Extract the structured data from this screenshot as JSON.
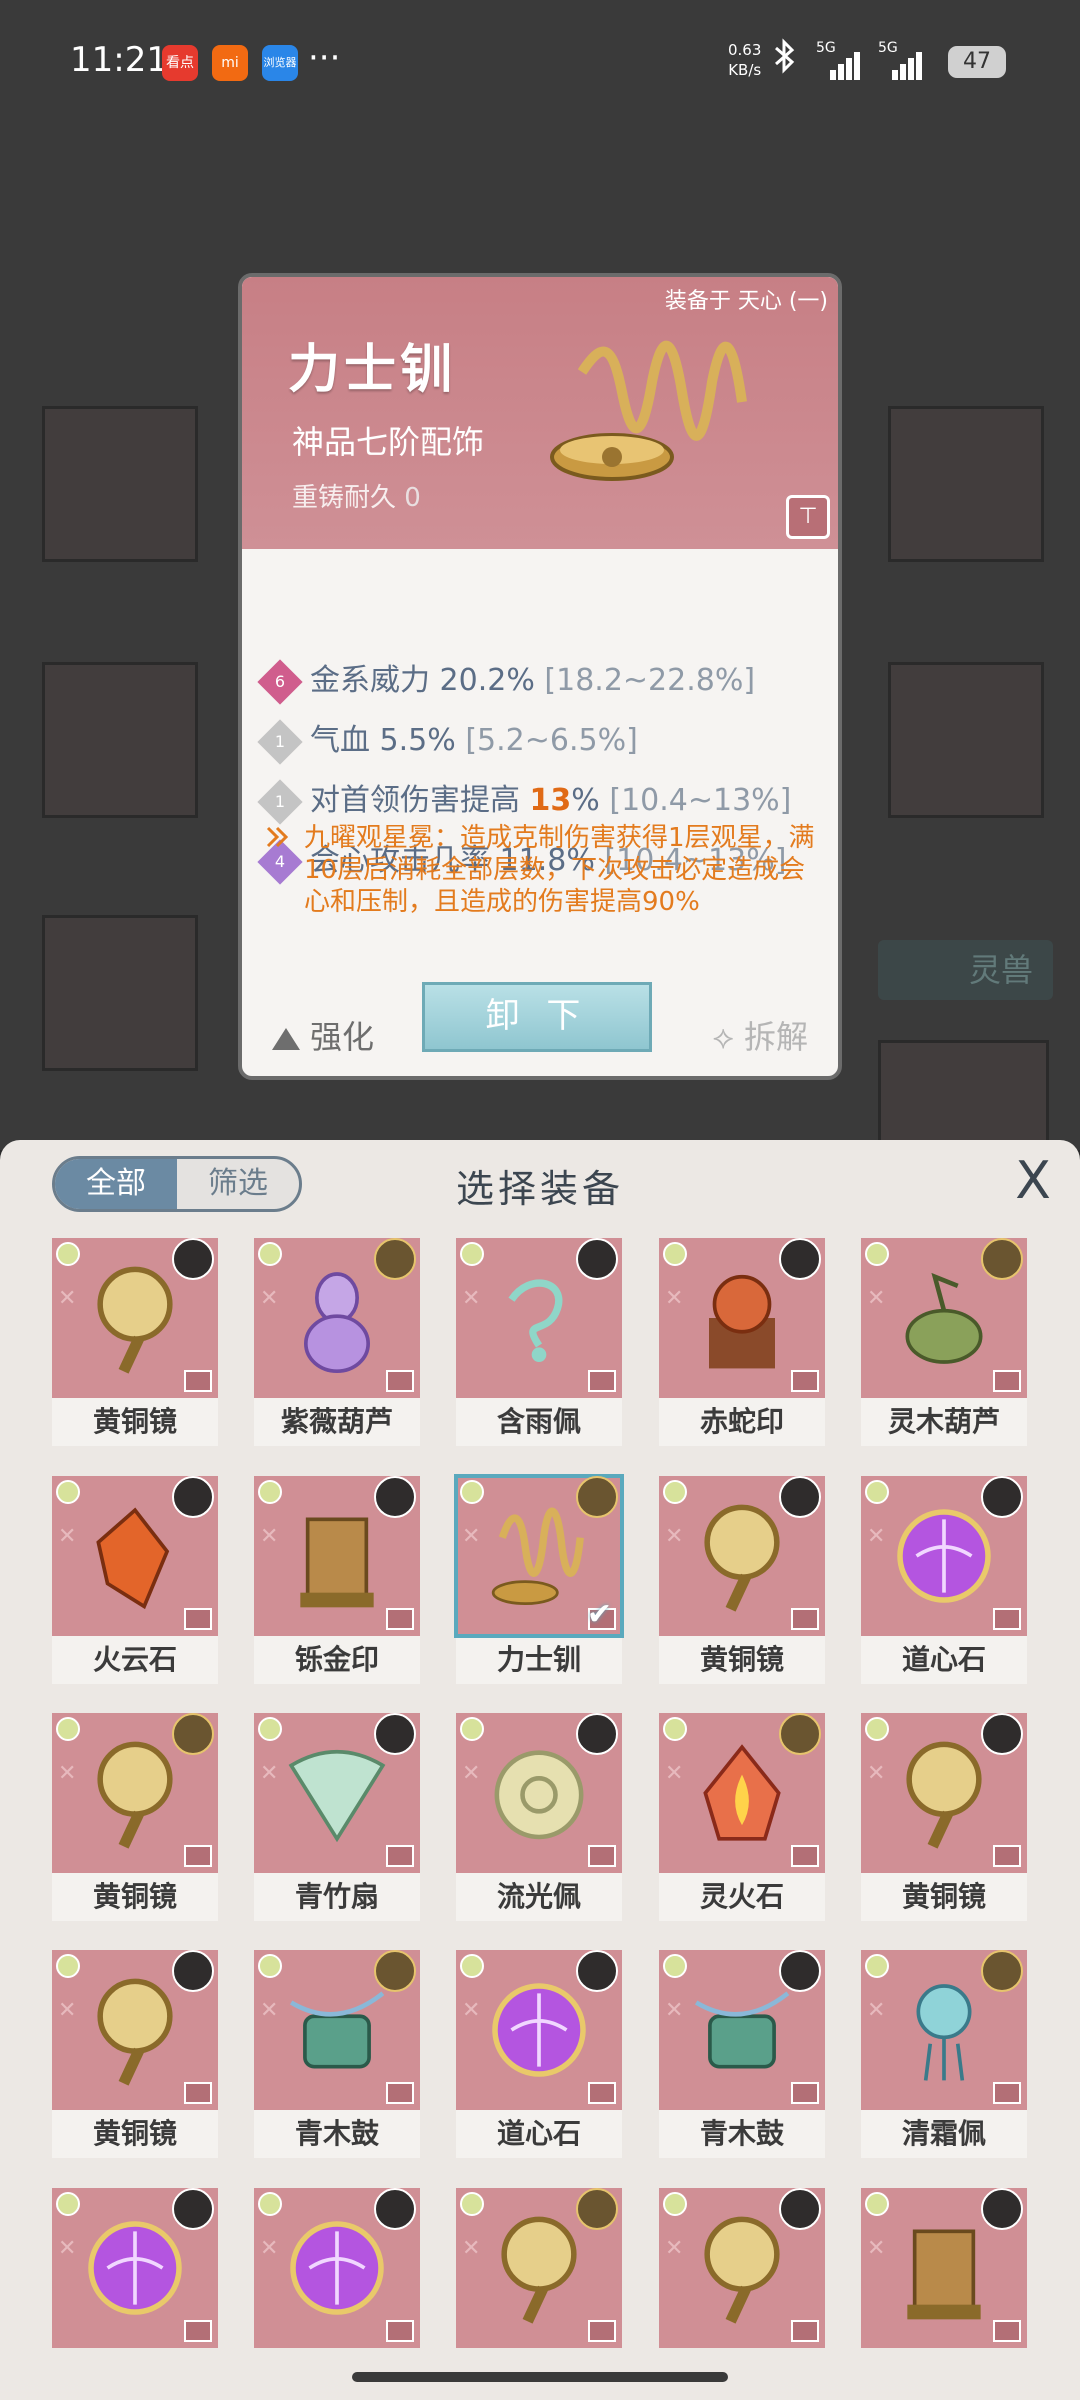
{
  "status_bar": {
    "time": "11:21",
    "apps": [
      "看点",
      "mi",
      "浏览器"
    ],
    "more": "···",
    "net_speed_value": "0.63",
    "net_speed_unit": "KB/s",
    "sim1": "5G",
    "sim2": "5G",
    "battery": "47"
  },
  "background": {
    "tag_label": "灵兽"
  },
  "detail": {
    "equipped_on": "装备于 天心 (一)",
    "name": "力士钏",
    "tier": "神品七阶配饰",
    "reforge_label": "重铸耐久",
    "reforge_value": "0",
    "attributes": [
      {
        "level": "6",
        "name": "金系威力",
        "value": "20.2%",
        "range": "[18.2~22.8%]",
        "color": "#d05d8d"
      },
      {
        "level": "1",
        "name": "气血",
        "value": "5.5%",
        "range": "[5.2~6.5%]",
        "color": "#c4c4c4"
      },
      {
        "level": "1",
        "name": "对首领伤害提高",
        "value_highlight": "13",
        "value_suffix": "%",
        "range": "[10.4~13%]",
        "color": "#c4c4c4"
      },
      {
        "level": "4",
        "name": "会心攻击几率",
        "value": "11.8%",
        "range": "[10.4~13%]",
        "color": "#a77bd2"
      }
    ],
    "special_text": "九曜观星冕：造成克制伤害获得1层观星，满10层后消耗全部层数，下次攻击必定造成会心和压制，且造成的伤害提高90%",
    "enhance_label": "强化",
    "unequip_label": "卸 下",
    "dismantle_label": "拆解"
  },
  "picker": {
    "tab_all": "全部",
    "tab_filter": "筛选",
    "title": "选择装备",
    "close": "X",
    "items": [
      {
        "label": "黄铜镜",
        "icon": "bronze-mirror"
      },
      {
        "label": "紫薇葫芦",
        "icon": "purple-gourd"
      },
      {
        "label": "含雨佩",
        "icon": "jade-pendant"
      },
      {
        "label": "赤蛇印",
        "icon": "red-snake-seal"
      },
      {
        "label": "灵木葫芦",
        "icon": "green-gourd"
      },
      {
        "label": "火云石",
        "icon": "fire-crystal"
      },
      {
        "label": "铄金印",
        "icon": "gold-seal"
      },
      {
        "label": "力士钏",
        "icon": "gold-bracelet",
        "selected": true
      },
      {
        "label": "黄铜镜",
        "icon": "bronze-mirror"
      },
      {
        "label": "道心石",
        "icon": "purple-orb"
      },
      {
        "label": "黄铜镜",
        "icon": "bronze-mirror"
      },
      {
        "label": "青竹扇",
        "icon": "bamboo-fan"
      },
      {
        "label": "流光佩",
        "icon": "jade-disc"
      },
      {
        "label": "灵火石",
        "icon": "fire-stone"
      },
      {
        "label": "黄铜镜",
        "icon": "bronze-mirror"
      },
      {
        "label": "黄铜镜",
        "icon": "bronze-mirror"
      },
      {
        "label": "青木鼓",
        "icon": "green-drum"
      },
      {
        "label": "道心石",
        "icon": "purple-orb"
      },
      {
        "label": "青木鼓",
        "icon": "green-drum"
      },
      {
        "label": "清霜佩",
        "icon": "frost-pendant"
      },
      {
        "label": "",
        "icon": "purple-orb"
      },
      {
        "label": "",
        "icon": "purple-orb"
      },
      {
        "label": "",
        "icon": "bronze-mirror"
      },
      {
        "label": "",
        "icon": "bronze-mirror"
      },
      {
        "label": "",
        "icon": "gold-seal"
      }
    ]
  }
}
